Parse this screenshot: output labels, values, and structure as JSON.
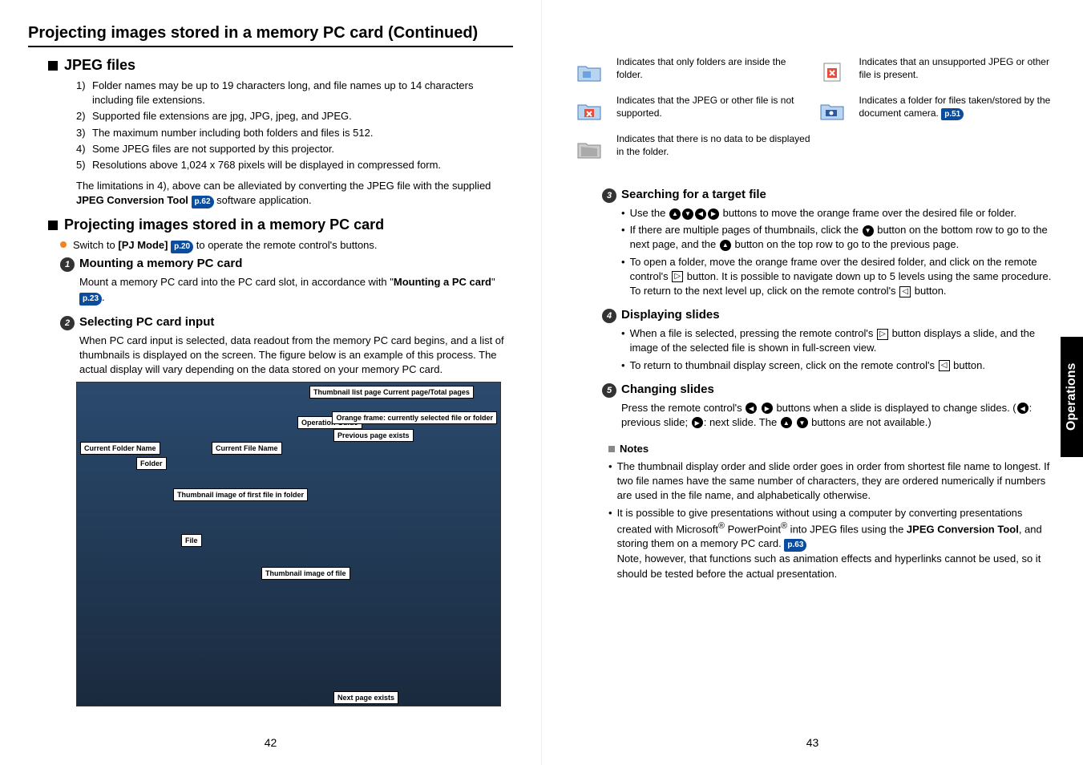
{
  "main_title": "Projecting images stored in a memory PC card (Continued)",
  "left_page_num": "42",
  "right_page_num": "43",
  "side_tab": "Operations",
  "jpeg_section": {
    "title": "JPEG files",
    "items": [
      "Folder names may be up to 19 characters long, and file names up to 14 characters including file extensions.",
      "Supported file extensions are jpg, JPG, jpeg, and JPEG.",
      "The maximum number including both folders and files is 512.",
      "Some JPEG files are not supported by this projector.",
      "Resolutions above 1,024 x 768 pixels will be displayed in compressed form."
    ],
    "limitation_pre": "The limitations in 4), above can be alleviated by converting the JPEG file with the supplied ",
    "tool": "JPEG Conversion Tool",
    "pref": "p.62",
    "limitation_post": " software application."
  },
  "proj_section": {
    "title": "Projecting images stored in a memory PC card",
    "switch_pre": "Switch to ",
    "pj_mode": "[PJ Mode]",
    "pref": "p.20",
    "switch_post": " to operate the remote control's buttons."
  },
  "step1": {
    "title": "Mounting a memory PC card",
    "text_pre": "Mount a memory PC card into the PC card slot, in accordance with \"",
    "bold": "Mounting a PC card",
    "text_mid": "\" ",
    "pref": "p.23",
    "text_post": "."
  },
  "step2": {
    "title": "Selecting PC card input",
    "text": "When PC card input is selected, data readout from the memory PC card begins, and a list of thumbnails is displayed on the screen. The figure below is an example of this process. The actual display will vary depending on the data stored on your memory PC card."
  },
  "thumb_labels": {
    "tl_page": "Thumbnail list page Current page/Total pages",
    "op_guide": "Operation Guide",
    "prev_page": "Previous page exists",
    "orange_frame": "Orange frame: currently selected file or folder",
    "cur_folder": "Current Folder Name",
    "cur_file": "Current File Name",
    "folder": "Folder",
    "thumb_first": "Thumbnail image of first file in folder",
    "file": "File",
    "thumb_file": "Thumbnail image of file",
    "next_page": "Next page exists"
  },
  "legend": [
    {
      "icon": "folder-blue",
      "text": "Indicates that only folders are inside the folder."
    },
    {
      "icon": "folder-x",
      "text": "Indicates that the JPEG or other file is not supported."
    },
    {
      "icon": "folder-empty",
      "text": "Indicates that there is no data to be displayed in the folder."
    },
    {
      "icon": "file-x",
      "text": "Indicates that an unsupported JPEG or other file is present."
    },
    {
      "icon": "camera-folder",
      "text": "Indicates a folder for files taken/stored by the document camera.",
      "pref": "p.51"
    }
  ],
  "step3": {
    "title": "Searching for a target file",
    "b1": "Use the ⬆⬇⬅➡ buttons to move the orange frame over the desired file or folder.",
    "b2": "If there are multiple pages of thumbnails, click the ⬇ button on the bottom row to go to the next page, and the ⬆ button on the top row to go to the previous page.",
    "b3": "To open a folder, move the orange frame over the desired folder, and click on the remote control's ▶ button. It is possible to navigate down up to 5 levels using the same procedure.",
    "b3b": "To return to the next level up, click on the remote control's ◀ button."
  },
  "step4": {
    "title": "Displaying slides",
    "b1": "When a file is selected, pressing the remote control's ▶ button displays a slide, and the image of the selected file is shown in full-screen view.",
    "b2": "To return to thumbnail display screen, click on the remote control's ◀ button."
  },
  "step5": {
    "title": "Changing slides",
    "text": "Press the remote control's ⬅ ➡ buttons when a slide is displayed to change slides. (⬅: previous slide; ➡: next slide. The ⬆ ⬇ buttons are not available.)"
  },
  "notes": {
    "title": "Notes",
    "n1": "The thumbnail display order and slide order goes in order from shortest file name to longest. If two file names have the same number of characters, they are ordered numerically if numbers are used in the file name, and alphabetically otherwise.",
    "n2_pre": "It is possible to give presentations without using a computer by converting presentations created with Microsoft",
    "n2_mid": " PowerPoint",
    "n2_post": " into JPEG files using the ",
    "tool": "JPEG Conversion Tool",
    "n2_end": ", and storing them on a memory PC card. ",
    "pref": "p.63",
    "n2_note": "Note, however, that functions such as animation effects and hyperlinks cannot be used, so it should be tested before the actual presentation."
  }
}
